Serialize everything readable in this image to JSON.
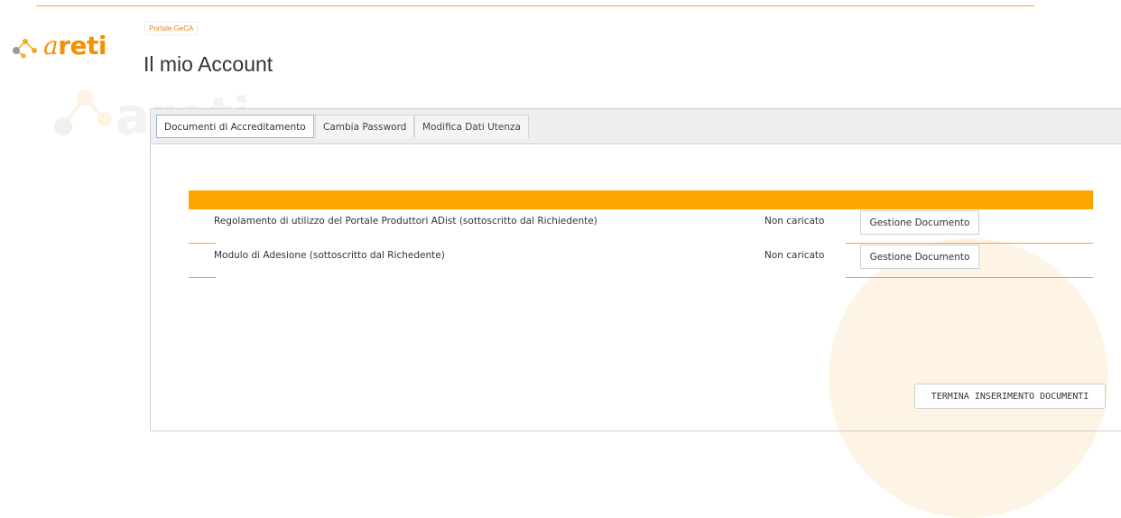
{
  "brand": {
    "logo_text": "areti",
    "accent_color": "#f39200"
  },
  "breadcrumb": "Portale GeCA",
  "page_title": "Il mio Account",
  "tabs": [
    {
      "label": "Documenti di Accreditamento",
      "active": true
    },
    {
      "label": "Cambia Password",
      "active": false
    },
    {
      "label": "Modifica Dati Utenza",
      "active": false
    }
  ],
  "documents": [
    {
      "name": "Regolamento di utilizzo del Portale Produttori ADist (sottoscritto dal Richiedente)",
      "status": "Non caricato",
      "action": "Gestione Documento"
    },
    {
      "name": "Modulo di Adesione (sottoscritto dal Richedente)",
      "status": "Non caricato",
      "action": "Gestione Documento"
    }
  ],
  "finish_button": "TERMINA INSERIMENTO DOCUMENTI",
  "icons": {
    "logo": "molecule-logo-icon",
    "watermark": "molecule-watermark-icon"
  }
}
